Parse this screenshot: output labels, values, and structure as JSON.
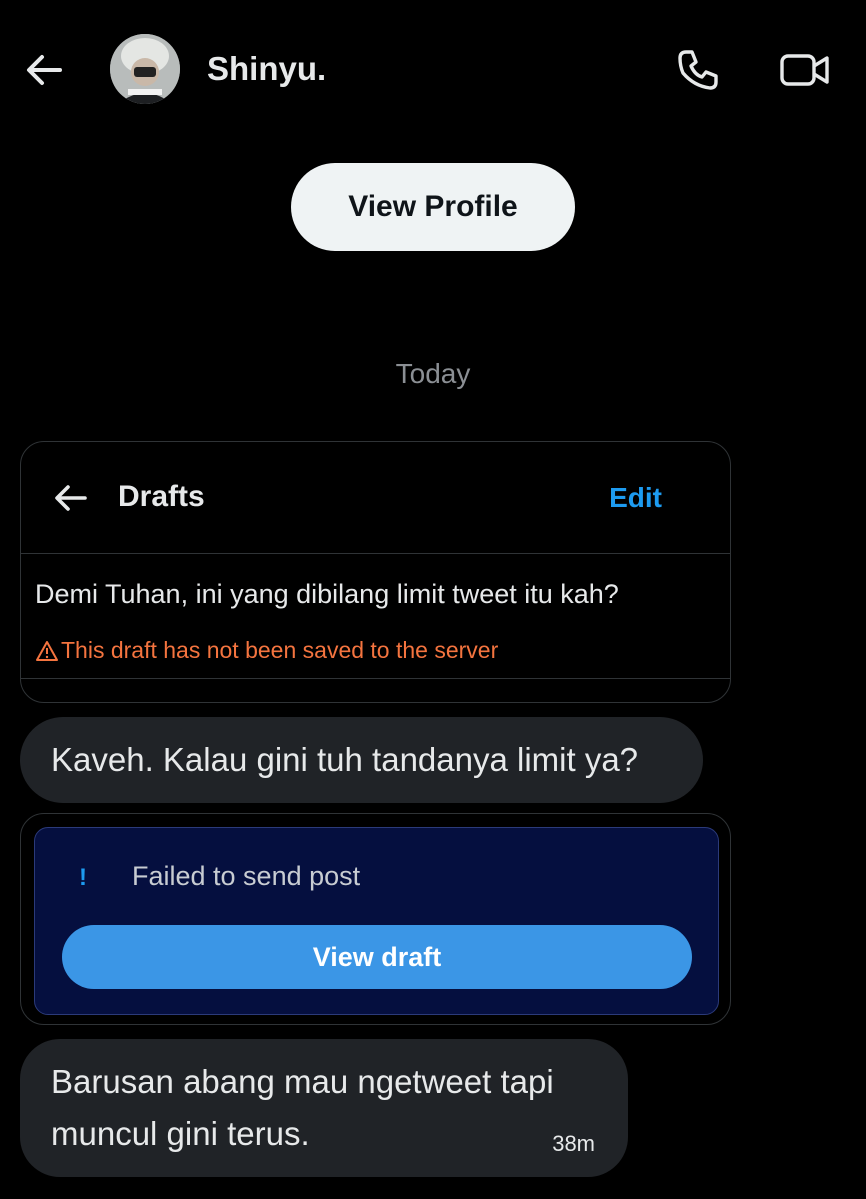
{
  "header": {
    "name": "Shinyu.",
    "back_icon": "arrow-left-icon",
    "call_icon": "phone-icon",
    "video_icon": "video-camera-icon"
  },
  "profile_button": "View Profile",
  "date_separator": "Today",
  "drafts_card": {
    "title": "Drafts",
    "edit_label": "Edit",
    "draft_text": "Demi Tuhan, ini yang dibilang limit tweet itu kah?",
    "warning_text": "This draft has not been saved to the server",
    "warning_icon": "warning-triangle-icon"
  },
  "messages": [
    {
      "text": "Kaveh. Kalau gini tuh tandanya limit ya?"
    },
    {
      "line1": "Barusan abang mau ngetweet tapi",
      "line2": "muncul gini terus.",
      "time": "38m"
    }
  ],
  "failed_card": {
    "icon": "!",
    "text": "Failed to send post",
    "button_label": "View draft"
  },
  "colors": {
    "background": "#000000",
    "bubble": "#202327",
    "accent": "#1d9bf0",
    "warning": "#f4743f",
    "failed_bg": "#050f3f",
    "view_draft_button": "#3b96e6"
  }
}
